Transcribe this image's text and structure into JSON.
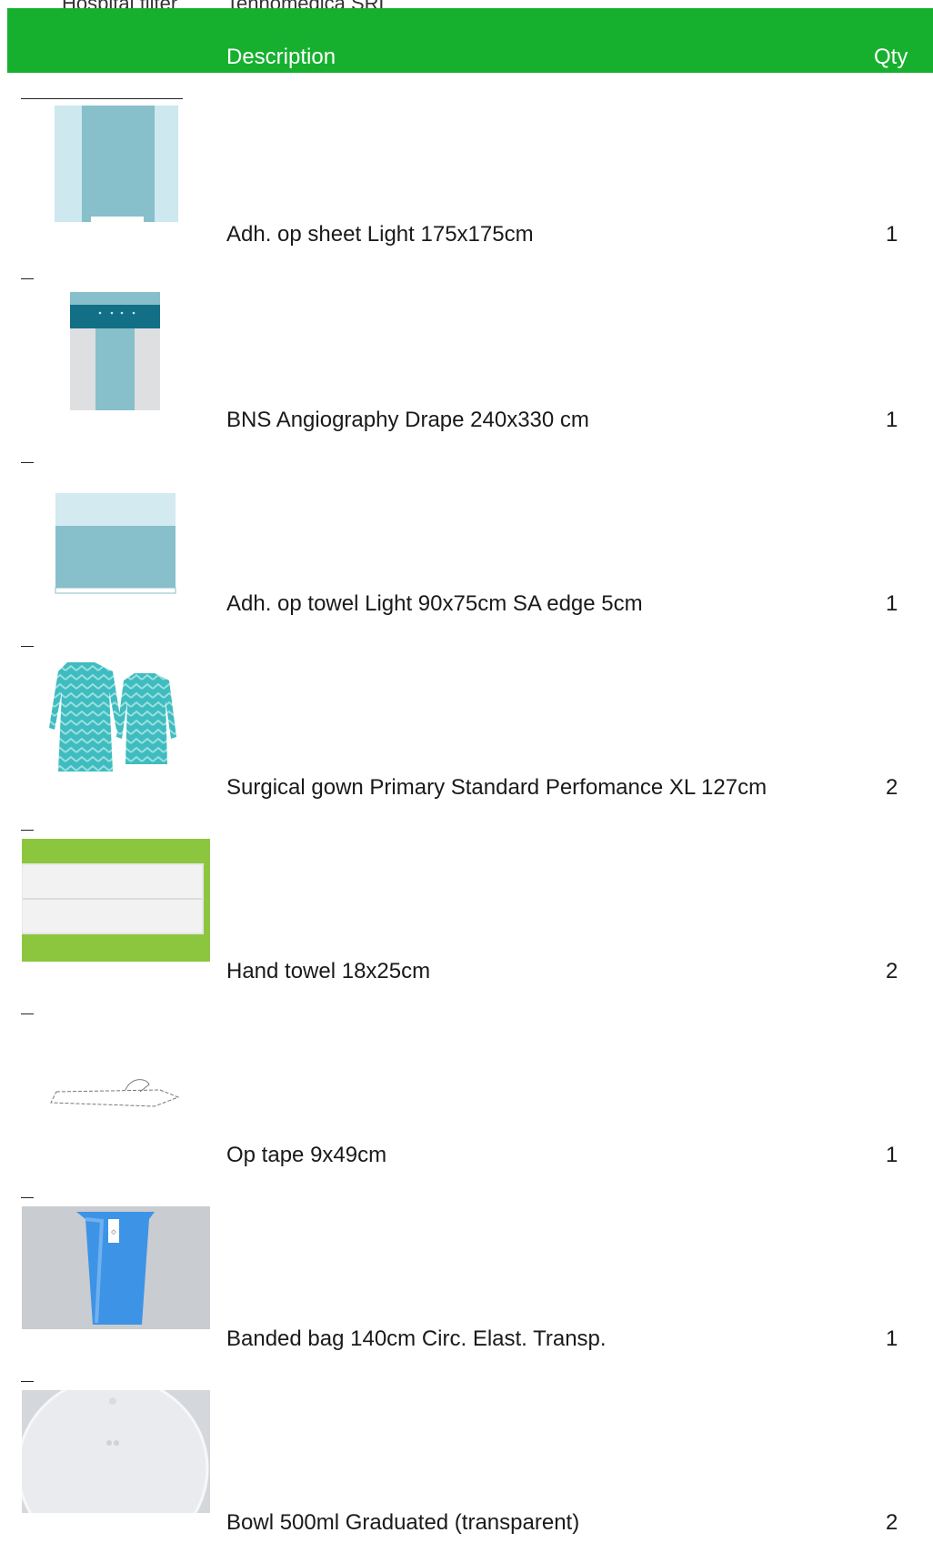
{
  "meta": {
    "label": "Hospital filter",
    "value": "Tennomedica SRL"
  },
  "table": {
    "col_description": "Description",
    "col_qty": "Qty"
  },
  "rows": [
    {
      "description": "Adh. op sheet Light 175x175cm",
      "qty": "1",
      "image": "adhesive-sheet-icon"
    },
    {
      "description": "BNS Angiography Drape 240x330 cm",
      "qty": "1",
      "image": "angiography-drape-icon"
    },
    {
      "description": "Adh. op towel Light 90x75cm SA edge 5cm",
      "qty": "1",
      "image": "adhesive-towel-icon"
    },
    {
      "description": "Surgical gown Primary Standard Perfomance XL 127cm",
      "qty": "2",
      "image": "surgical-gown-icon"
    },
    {
      "description": "Hand towel 18x25cm",
      "qty": "2",
      "image": "hand-towel-photo"
    },
    {
      "description": "Op tape 9x49cm",
      "qty": "1",
      "image": "op-tape-icon"
    },
    {
      "description": "Banded bag 140cm Circ. Elast. Transp.",
      "qty": "1",
      "image": "banded-bag-photo"
    },
    {
      "description": "Bowl 500ml Graduated (transparent)",
      "qty": "2",
      "image": "bowl-photo"
    }
  ]
}
